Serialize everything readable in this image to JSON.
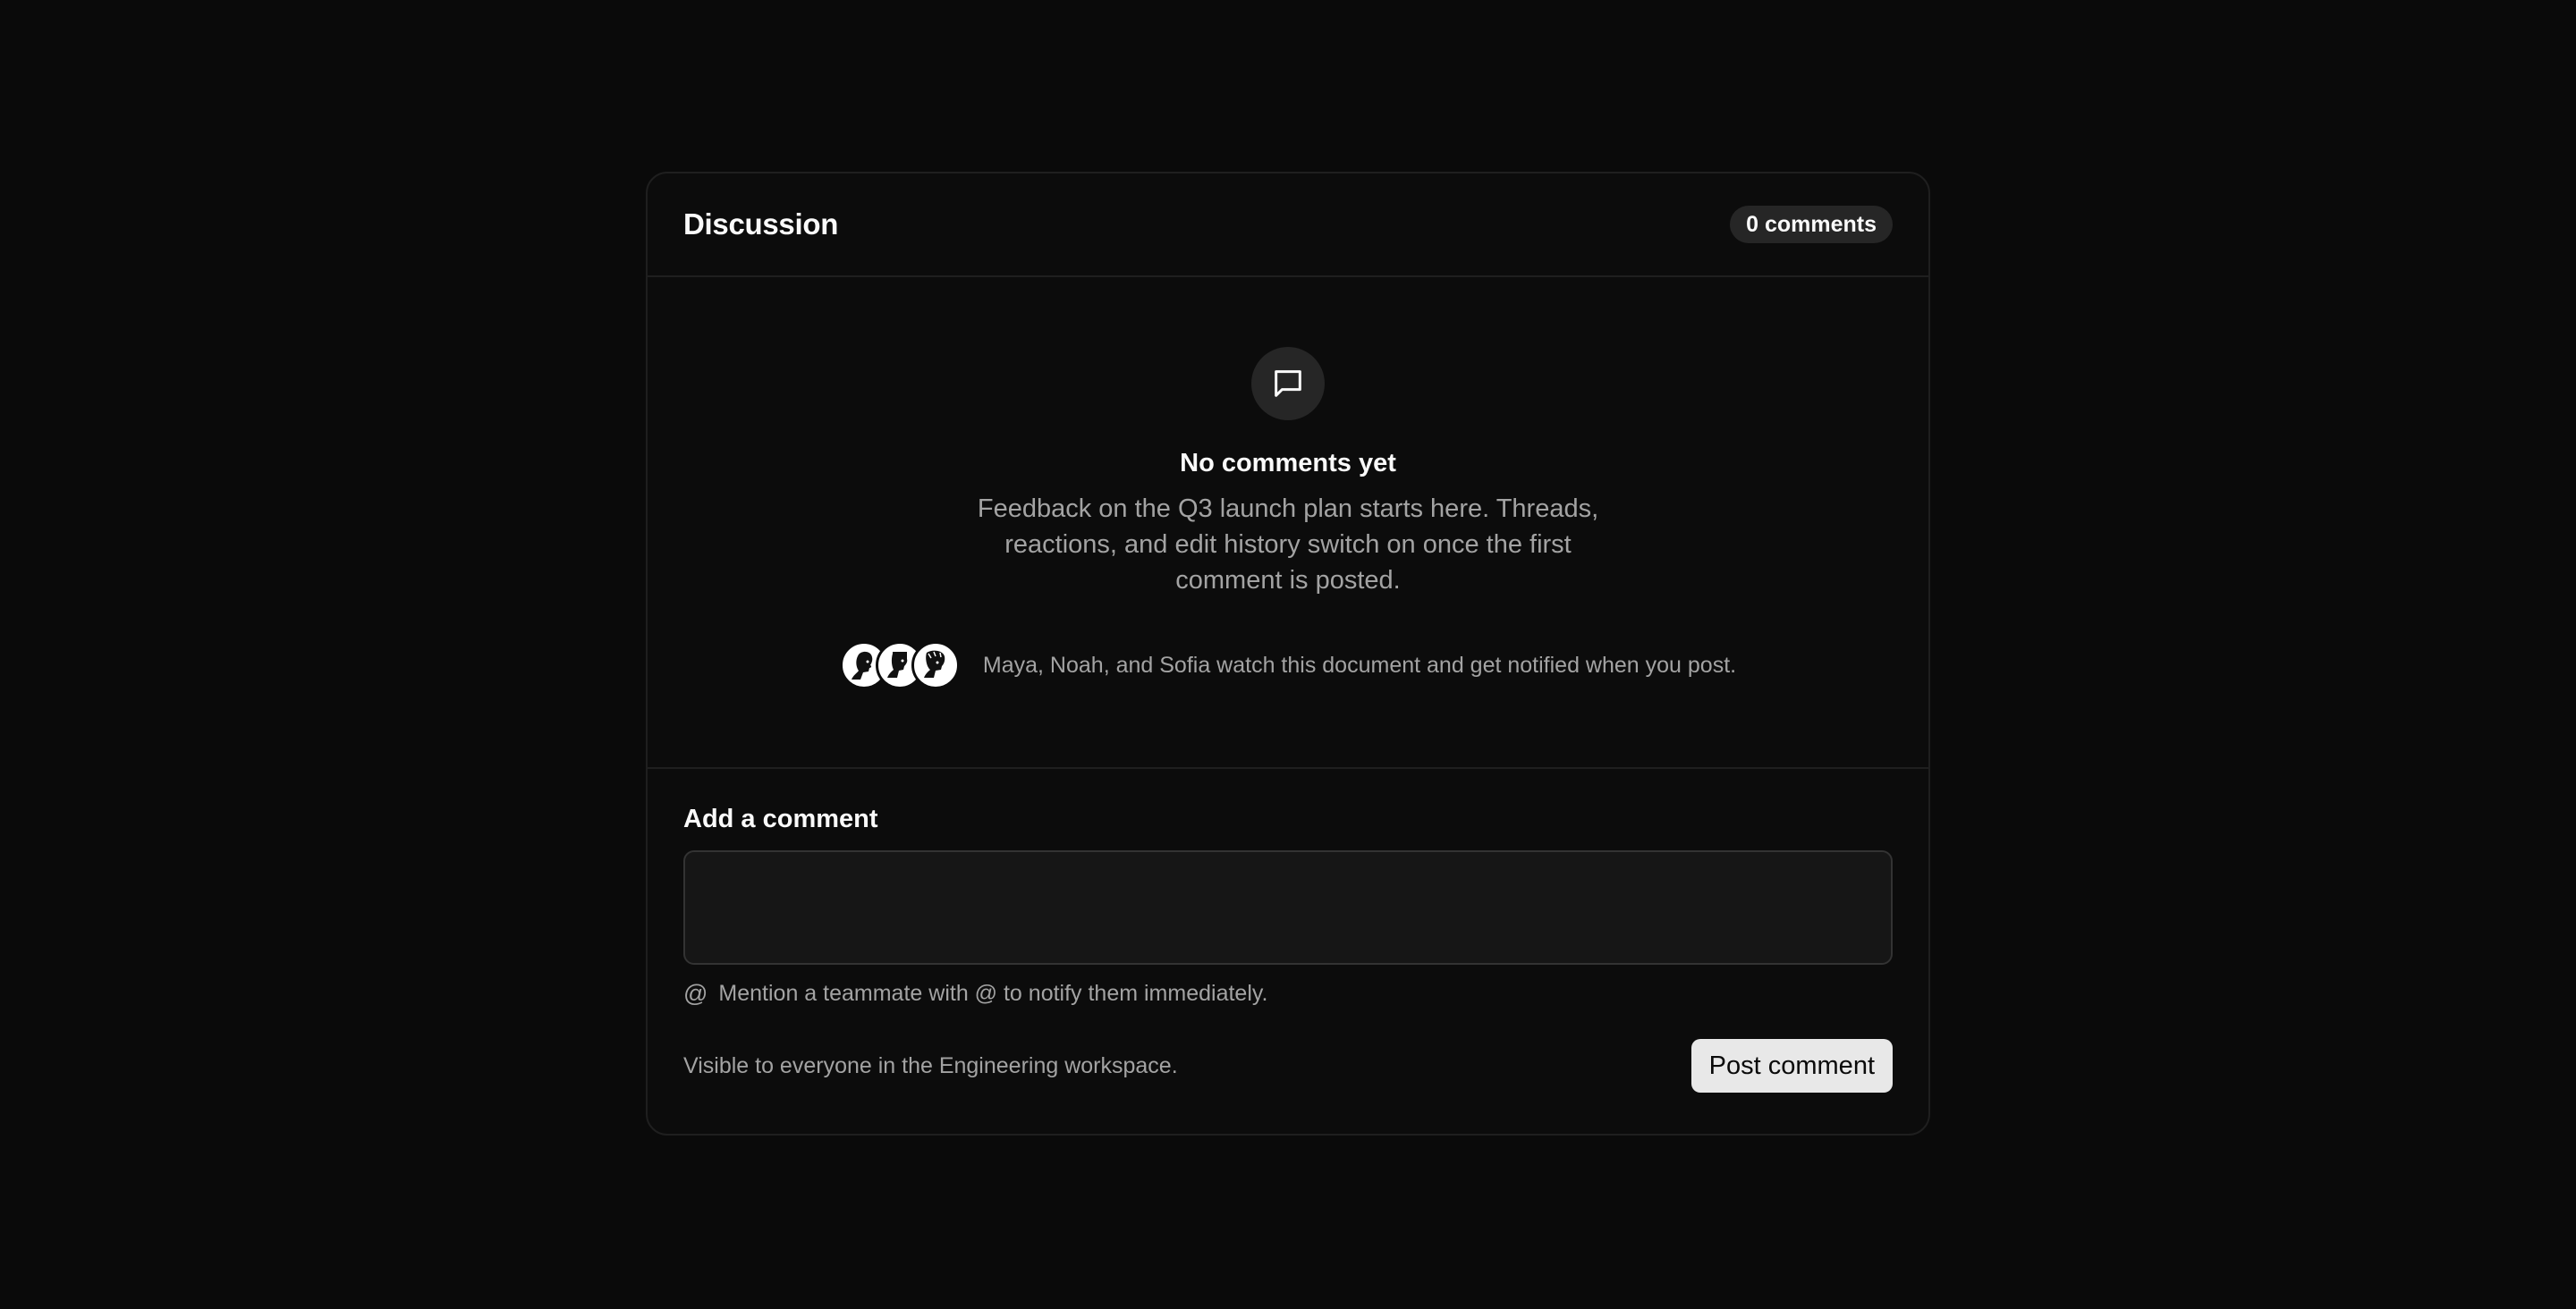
{
  "header": {
    "title": "Discussion",
    "comment_count": "0 comments"
  },
  "empty_state": {
    "icon": "message-square-icon",
    "title": "No comments yet",
    "description": "Feedback on the Q3 launch plan starts here. Threads, reactions, and edit history switch on once the first comment is posted.",
    "watchers_text": "Maya, Noah, and Sofia watch this document and get notified when you post."
  },
  "compose": {
    "label": "Add a comment",
    "value": "",
    "placeholder": "",
    "hint_icon": "at-sign-icon",
    "hint": "Mention a teammate with @ to notify them immediately.",
    "visibility": "Visible to everyone in the Engineering workspace.",
    "post_label": "Post comment"
  },
  "colors": {
    "background": "#0a0a0a",
    "card": "#0c0c0c",
    "border": "#1f1f1f",
    "muted_text": "#a3a3a3",
    "button": "#e8e8e8"
  }
}
